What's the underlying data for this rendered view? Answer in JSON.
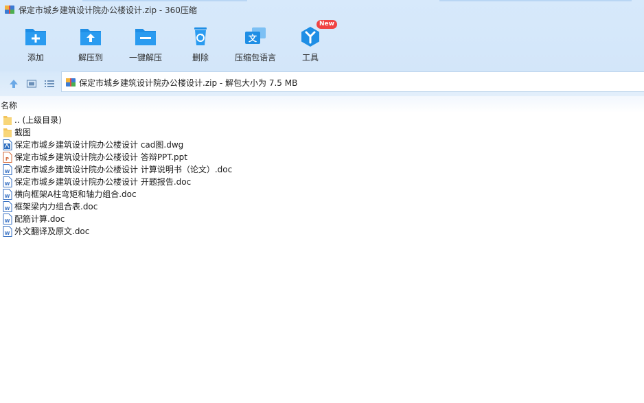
{
  "window": {
    "title": "保定市城乡建筑设计院办公楼设计.zip - 360压缩"
  },
  "toolbar": {
    "items": [
      {
        "label": "添加",
        "icon": "add-icon"
      },
      {
        "label": "解压到",
        "icon": "extract-to-icon"
      },
      {
        "label": "一键解压",
        "icon": "one-click-extract-icon"
      },
      {
        "label": "删除",
        "icon": "recycle-delete-icon"
      },
      {
        "label": "压缩包语言",
        "icon": "language-icon"
      },
      {
        "label": "工具",
        "icon": "tools-icon",
        "badge": "New"
      }
    ]
  },
  "address": {
    "text": "保定市城乡建筑设计院办公楼设计.zip - 解包大小为 7.5 MB"
  },
  "list": {
    "column_name": "名称",
    "items": [
      {
        "name": ".. (上级目录)",
        "type": "folder"
      },
      {
        "name": "截图",
        "type": "folder"
      },
      {
        "name": "保定市城乡建筑设计院办公楼设计 cad图.dwg",
        "type": "dwg"
      },
      {
        "name": "保定市城乡建筑设计院办公楼设计 答辩PPT.ppt",
        "type": "ppt"
      },
      {
        "name": "保定市城乡建筑设计院办公楼设计 计算说明书（论文）.doc",
        "type": "doc"
      },
      {
        "name": "保定市城乡建筑设计院办公楼设计 开题报告.doc",
        "type": "doc"
      },
      {
        "name": "横向框架A柱弯矩和轴力组合.doc",
        "type": "doc"
      },
      {
        "name": "框架梁内力组合表.doc",
        "type": "doc"
      },
      {
        "name": "配筋计算.doc",
        "type": "doc"
      },
      {
        "name": "外文翻译及原文.doc",
        "type": "doc"
      }
    ]
  },
  "colors": {
    "header_bg": "#d7e9fb",
    "icon_blue": "#1f8fe6",
    "badge_red": "#f04343"
  }
}
